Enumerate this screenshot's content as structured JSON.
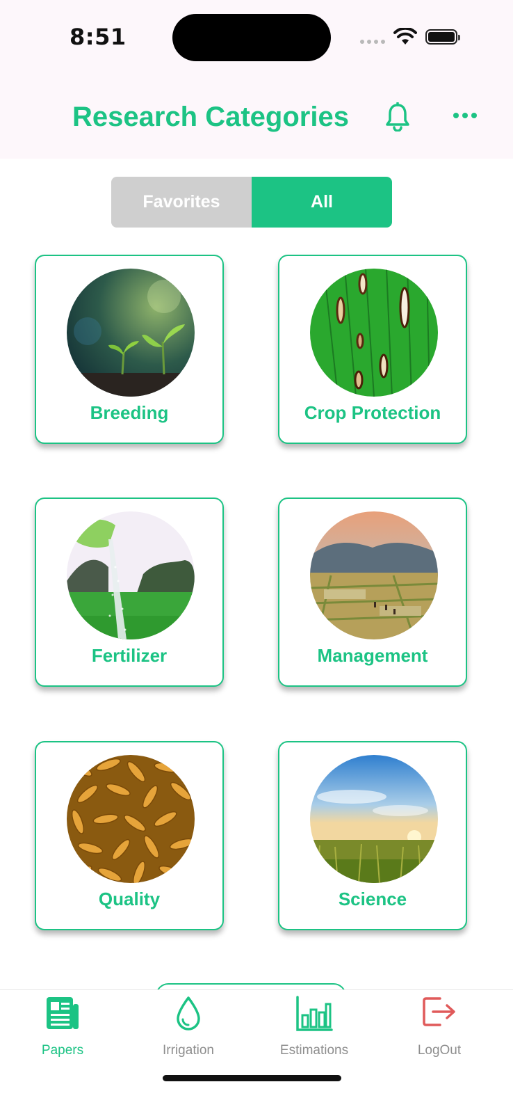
{
  "status": {
    "time": "8:51"
  },
  "header": {
    "title": "Research Categories"
  },
  "segment": {
    "favorites": "Favorites",
    "all": "All",
    "selected": "All"
  },
  "categories": [
    {
      "label": "Breeding",
      "image": "seedlings-photo"
    },
    {
      "label": "Crop Protection",
      "image": "diseased-leaf-photo"
    },
    {
      "label": "Fertilizer",
      "image": "fertilizer-spread-photo"
    },
    {
      "label": "Management",
      "image": "paddy-field-photo"
    },
    {
      "label": "Quality",
      "image": "rice-grains-photo"
    },
    {
      "label": "Science",
      "image": "field-sunset-photo"
    }
  ],
  "tabs": [
    {
      "label": "Papers",
      "icon": "newspaper-icon",
      "active": true
    },
    {
      "label": "Irrigation",
      "icon": "water-drop-icon",
      "active": false
    },
    {
      "label": "Estimations",
      "icon": "bar-chart-icon",
      "active": false
    },
    {
      "label": "LogOut",
      "icon": "logout-icon",
      "active": false
    }
  ],
  "colors": {
    "accent": "#1cc384",
    "inactive": "#cfcfcf",
    "logout": "#e05a5a"
  }
}
